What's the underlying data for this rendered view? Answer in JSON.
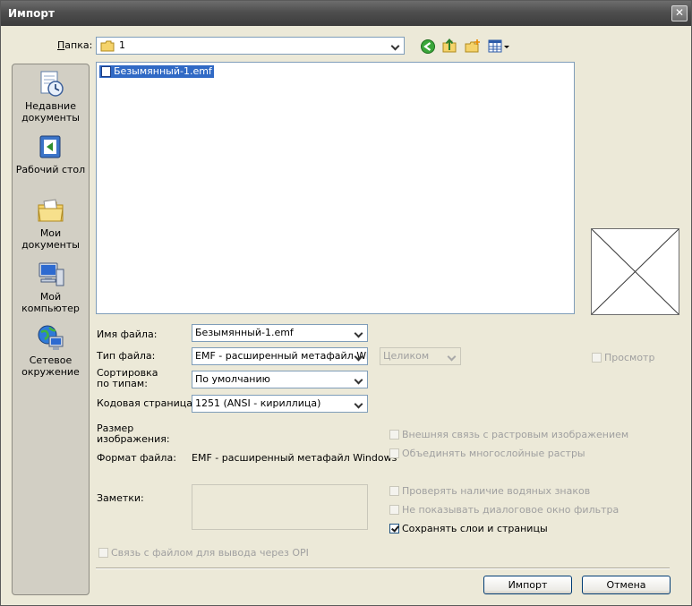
{
  "window": {
    "title": "Импорт",
    "close_glyph": "✕"
  },
  "folder": {
    "label": "Папка:",
    "value": "1"
  },
  "places": [
    {
      "label": "Недавние документы",
      "icon": "recent-documents-icon"
    },
    {
      "label": "Рабочий стол",
      "icon": "desktop-icon"
    },
    {
      "label": "Мои документы",
      "icon": "my-documents-icon"
    },
    {
      "label": "Мой компьютер",
      "icon": "my-computer-icon"
    },
    {
      "label": "Сетевое окружение",
      "icon": "network-icon"
    }
  ],
  "files": [
    {
      "name": "Безымянный-1.emf"
    }
  ],
  "fields": {
    "filename_label": "Имя файла:",
    "filename_value": "Безымянный-1.emf",
    "filetype_label": "Тип файла:",
    "filetype_value": "EMF - расширенный метафайл Windows",
    "sort_label_1": "Сортировка",
    "sort_label_2": "по типам:",
    "sort_value": "По умолчанию",
    "codepage_label": "Кодовая страница:",
    "codepage_value": "1251  (ANSI - кириллица)",
    "crop_value": "Целиком",
    "size_label_1": "Размер",
    "size_label_2": "изображения:",
    "format_label": "Формат файла:",
    "format_value": "EMF - расширенный метафайл Windows",
    "notes_label": "Заметки:"
  },
  "options": {
    "preview": "Просмотр",
    "external_link": "Внешняя связь с растровым изображением",
    "combine_layers": "Объединять многослойные растры",
    "check_watermarks": "Проверять наличие водяных знаков",
    "hide_filter_dialog": "Не показывать диалоговое окно фильтра",
    "keep_layers_pages": "Сохранять слои и страницы",
    "opi_link": "Связь с файлом для вывода через OPI"
  },
  "buttons": {
    "import": "Импорт",
    "cancel": "Отмена"
  }
}
